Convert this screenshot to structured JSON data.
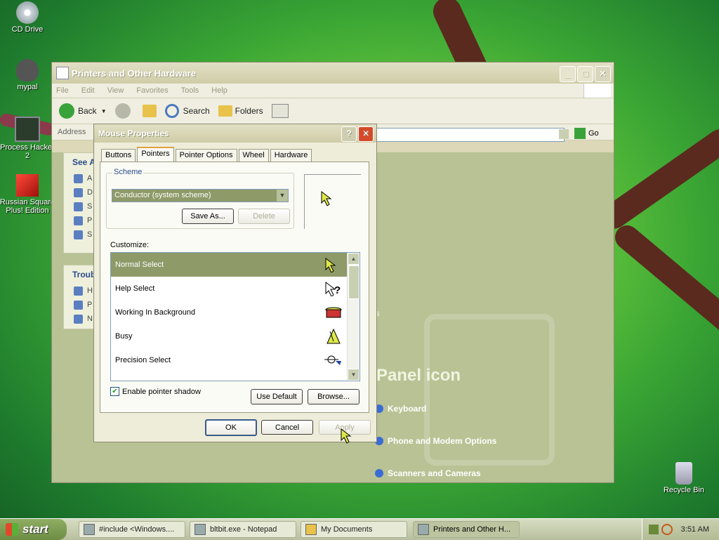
{
  "desktop": {
    "icons": [
      {
        "label": "CD Drive"
      },
      {
        "label": "mypal"
      },
      {
        "label": "Process Hacker 2"
      },
      {
        "label": "Russian Square Plus! Edition"
      },
      {
        "label": "Recycle Bin"
      }
    ]
  },
  "explorer": {
    "title": "Printers and Other Hardware",
    "menu": [
      "File",
      "Edit",
      "View",
      "Favorites",
      "Tools",
      "Help"
    ],
    "toolbar": {
      "back": "Back",
      "search": "Search",
      "folders": "Folders"
    },
    "address_label": "Address",
    "go_label": "Go",
    "taskpane": {
      "see_also_header": "See A",
      "see_also_items": [
        "A",
        "D",
        "S",
        "A",
        "P",
        "S"
      ],
      "troubleshoot_header": "Troub",
      "troubleshoot_items": [
        "H",
        "P",
        "N"
      ]
    },
    "panel_heading": "Panel icon",
    "partial_text": "s",
    "links": [
      "Keyboard",
      "Phone and Modem Options",
      "Scanners and Cameras"
    ]
  },
  "dialog": {
    "title": "Mouse Properties",
    "help_glyph": "?",
    "close_glyph": "✕",
    "tabs": [
      "Buttons",
      "Pointers",
      "Pointer Options",
      "Wheel",
      "Hardware"
    ],
    "active_tab": "Pointers",
    "scheme_label": "Scheme",
    "scheme_value": "Conductor (system scheme)",
    "save_as": "Save As...",
    "delete": "Delete",
    "customize_label": "Customize:",
    "pointers": [
      {
        "name": "Normal Select",
        "icon": "arrow-cursor-icon",
        "selected": true
      },
      {
        "name": "Help Select",
        "icon": "help-cursor-icon",
        "selected": false
      },
      {
        "name": "Working In Background",
        "icon": "drum-cursor-icon",
        "selected": false
      },
      {
        "name": "Busy",
        "icon": "metronome-cursor-icon",
        "selected": false
      },
      {
        "name": "Precision Select",
        "icon": "precision-cursor-icon",
        "selected": false
      }
    ],
    "enable_shadow": "Enable pointer shadow",
    "enable_shadow_checked": true,
    "use_default": "Use Default",
    "browse": "Browse...",
    "ok": "OK",
    "cancel": "Cancel",
    "apply": "Apply"
  },
  "taskbar": {
    "start": "start",
    "items": [
      {
        "label": "#include <Windows...."
      },
      {
        "label": "bltbit.exe - Notepad"
      },
      {
        "label": "My Documents"
      },
      {
        "label": "Printers and Other H..."
      }
    ],
    "clock": "3:51 AM"
  }
}
